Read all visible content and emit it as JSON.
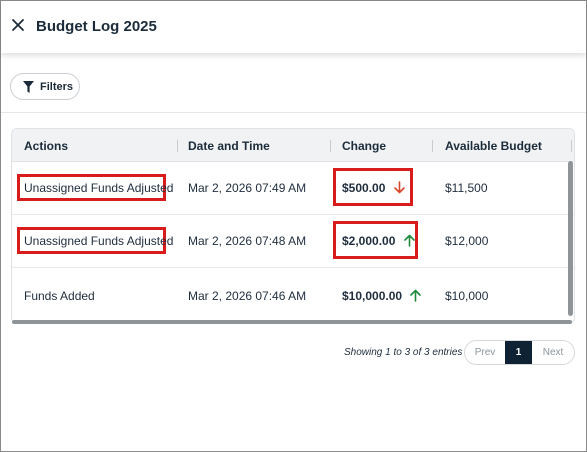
{
  "header": {
    "title": "Budget Log 2025"
  },
  "filters": {
    "label": "Filters"
  },
  "table": {
    "columns": [
      "Actions",
      "Date and Time",
      "Change",
      "Available Budget"
    ],
    "rows": [
      {
        "action": "Unassigned Funds Adjusted",
        "datetime": "Mar 2, 2026 07:49 AM",
        "change": "$500.00",
        "direction": "down",
        "available": "$11,500"
      },
      {
        "action": "Unassigned Funds Adjusted",
        "datetime": "Mar 2, 2026 07:48 AM",
        "change": "$2,000.00",
        "direction": "up",
        "available": "$12,000"
      },
      {
        "action": "Funds Added",
        "datetime": "Mar 2, 2026 07:46 AM",
        "change": "$10,000.00",
        "direction": "up",
        "available": "$10,000"
      }
    ]
  },
  "pagination": {
    "summary": "Showing 1 to 3 of 3 entries",
    "prev": "Prev",
    "current": "1",
    "next": "Next"
  },
  "colors": {
    "down_arrow": "#d9442b",
    "up_arrow": "#1e8a3a",
    "highlight": "#d81b1b",
    "active_page": "#0f2233"
  }
}
